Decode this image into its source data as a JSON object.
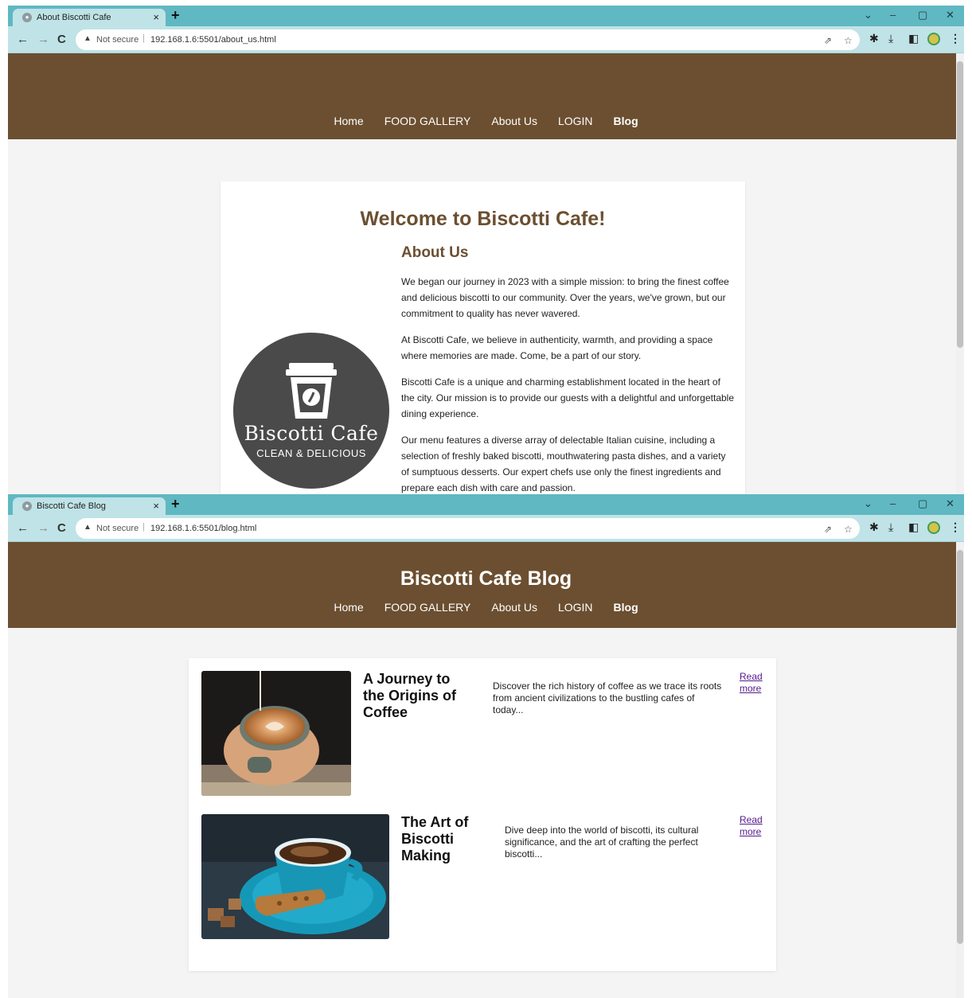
{
  "window1": {
    "tab_title": "About Biscotti Cafe",
    "not_secure": "Not secure",
    "url": "192.168.1.6:5501/about_us.html",
    "nav": [
      "Home",
      "FOOD GALLERY",
      "About Us",
      "LOGIN",
      "Blog"
    ],
    "heading": "Welcome to Biscotti Cafe!",
    "subheading": "About Us",
    "paragraphs": [
      "We began our journey in 2023 with a simple mission: to bring the finest coffee and delicious biscotti to our community. Over the years, we've grown, but our commitment to quality has never wavered.",
      "At Biscotti Cafe, we believe in authenticity, warmth, and providing a space where memories are made. Come, be a part of our story.",
      "Biscotti Cafe is a unique and charming establishment located in the heart of the city. Our mission is to provide our guests with a delightful and unforgettable dining experience.",
      "Our menu features a diverse array of delectable Italian cuisine, including a selection of freshly baked biscotti, mouthwatering pasta dishes, and a variety of sumptuous desserts. Our expert chefs use only the finest ingredients and prepare each dish with care and passion."
    ],
    "logo": {
      "brand": "Biscotti Cafe",
      "tagline": "CLEAN & DELICIOUS"
    }
  },
  "window2": {
    "tab_title": "Biscotti Cafe Blog",
    "not_secure": "Not secure",
    "url": "192.168.1.6:5501/blog.html",
    "site_title": "Biscotti Cafe Blog",
    "nav": [
      "Home",
      "FOOD GALLERY",
      "About Us",
      "LOGIN",
      "Blog"
    ],
    "posts": [
      {
        "title": "A Journey to the Origins of Coffee",
        "excerpt": "Discover the rich history of coffee as we trace its roots from ancient civilizations to the bustling cafes of today...",
        "link": "Read more"
      },
      {
        "title": "The Art of Biscotti Making",
        "excerpt": "Dive deep into the world of biscotti, its cultural significance, and the art of crafting the perfect biscotti...",
        "link": "Read more"
      }
    ]
  },
  "colors": {
    "brand_brown": "#6b4f30",
    "chrome_teal": "#5fb8c2",
    "chrome_light": "#bfe3e6"
  },
  "icons": [
    "back-icon",
    "forward-icon",
    "reload-icon",
    "warning-icon",
    "share-icon",
    "star-icon",
    "extensions-icon",
    "download-icon",
    "sidepanel-icon",
    "profile-icon",
    "menu-icon",
    "close-icon",
    "new-tab-icon"
  ]
}
